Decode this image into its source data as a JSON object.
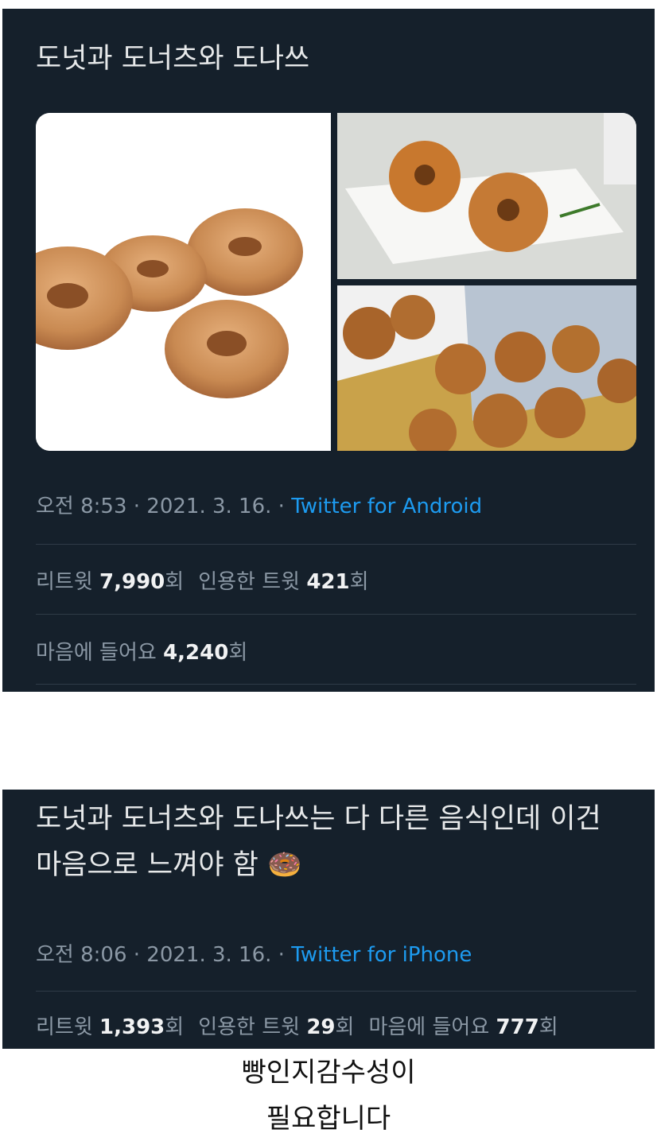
{
  "tweet1": {
    "text": "도넛과 도너츠와 도나쓰",
    "time": "오전 8:53 · 2021. 3. 16. · ",
    "source": "Twitter for Android",
    "retweets_label": "리트윗 ",
    "retweets_count": "7,990",
    "retweets_suffix": "회",
    "quotes_label": "인용한 트윗 ",
    "quotes_count": "421",
    "quotes_suffix": "회",
    "likes_label": "마음에 들어요 ",
    "likes_count": "4,240",
    "likes_suffix": "회"
  },
  "tweet2": {
    "text": "도넛과 도너츠와 도나쓰는 다 다른 음식인데 이건 마음으로 느껴야 함 ",
    "emoji": "🍩",
    "time": "오전 8:06 · 2021. 3. 16. · ",
    "source": "Twitter for iPhone",
    "retweets_label": "리트윗 ",
    "retweets_count": "1,393",
    "retweets_suffix": "회",
    "quotes_label": "인용한 트윗 ",
    "quotes_count": "29",
    "quotes_suffix": "회",
    "likes_label": "마음에 들어요 ",
    "likes_count": "777",
    "likes_suffix": "회"
  },
  "caption": {
    "line1": "빵인지감수성이",
    "line2": "필요합니다"
  },
  "colors": {
    "card_bg": "#15202b",
    "link": "#1d9bf0",
    "muted": "#8b98a5",
    "text": "#e7e9ea"
  }
}
